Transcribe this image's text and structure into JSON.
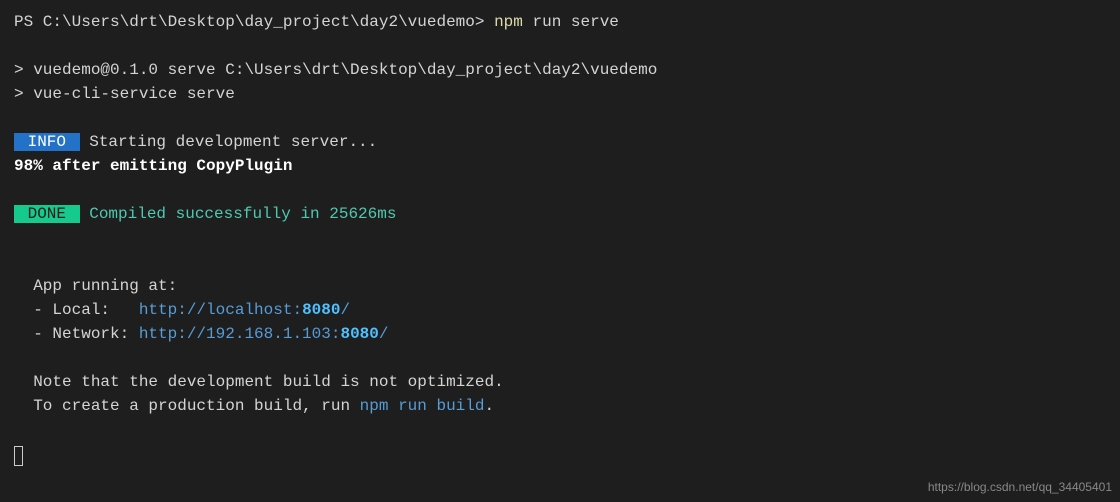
{
  "prompt": {
    "prefix": "PS C:\\Users\\drt\\Desktop\\day_project\\day2\\vuedemo> ",
    "command_highlighted": "npm",
    "command_rest": " run serve"
  },
  "script_lines": {
    "line1": "> vuedemo@0.1.0 serve C:\\Users\\drt\\Desktop\\day_project\\day2\\vuedemo",
    "line2": "> vue-cli-service serve"
  },
  "info": {
    "badge": " INFO ",
    "text": " Starting development server..."
  },
  "progress": "98% after emitting CopyPlugin",
  "done": {
    "badge": " DONE ",
    "text": " Compiled successfully in 25626ms"
  },
  "app": {
    "running_at": "  App running at:",
    "local_label": "  - Local:   ",
    "local_url_base": "http://localhost:",
    "local_port": "8080",
    "local_slash": "/",
    "network_label": "  - Network: ",
    "network_url_base": "http://192.168.1.103:",
    "network_port": "8080",
    "network_slash": "/"
  },
  "note": {
    "line1": "  Note that the development build is not optimized.",
    "line2_pre": "  To create a production build, run ",
    "line2_cmd": "npm run build",
    "line2_post": "."
  },
  "watermark": "https://blog.csdn.net/qq_34405401"
}
